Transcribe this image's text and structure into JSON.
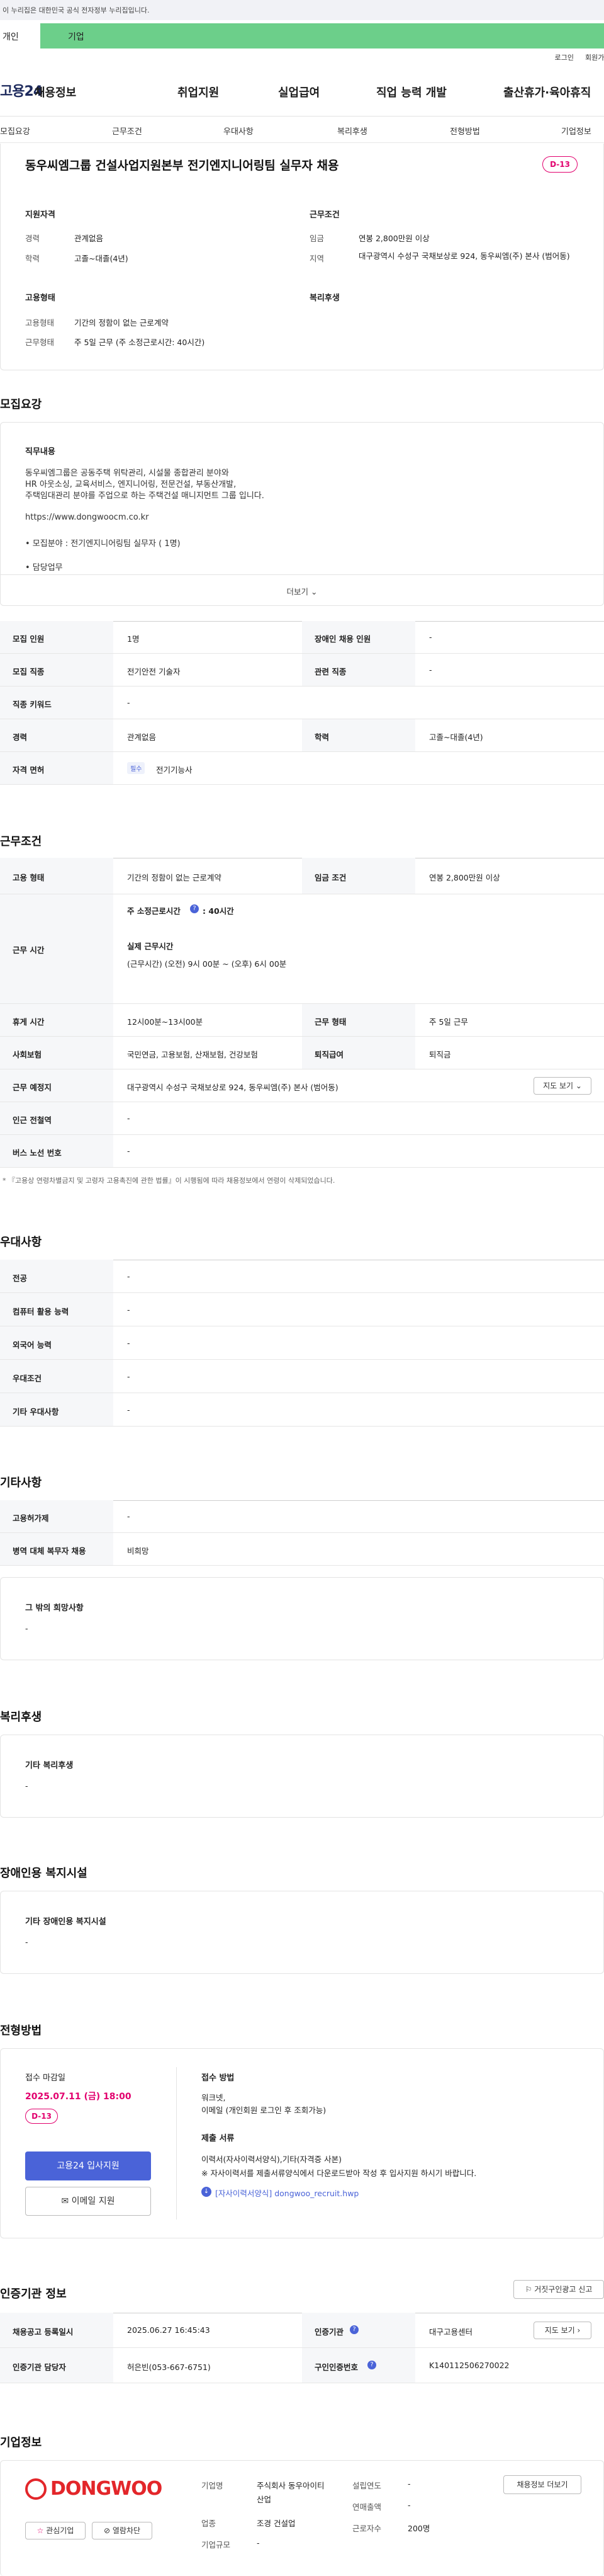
{
  "banner": {
    "text": "이 누리집은 대한민국 공식 전자정부 누리집입니다."
  },
  "segments": {
    "personal": "개인",
    "company": "기업"
  },
  "util": {
    "login": "로그인",
    "signup": "회원가입"
  },
  "gnb": {
    "logo": "고용24",
    "items": [
      "채용정보",
      "취업지원",
      "실업급여",
      "직업 능력 개발",
      "출산휴가·육아휴직"
    ]
  },
  "subnav": [
    "모집요강",
    "근무조건",
    "우대사항",
    "복리후생",
    "전형방법",
    "기업정보"
  ],
  "job": {
    "title": "동우씨엠그룹 건설사업지원본부 전기엔지니어링팀 실무자 채용",
    "dday": "D-13",
    "qual_title": "지원자격",
    "cond_title": "근무조건",
    "emp_title": "고용형태",
    "welfare_title": "복리후생",
    "qual": [
      {
        "k": "경력",
        "v": "관계없음"
      },
      {
        "k": "학력",
        "v": "고졸~대졸(4년)"
      }
    ],
    "cond": [
      {
        "k": "임금",
        "v": "연봉 2,800만원 이상"
      },
      {
        "k": "지역",
        "v": "대구광역시 수성구 국채보상로 924, 동우씨엠(주) 본사 (범어동)"
      }
    ],
    "emp": [
      {
        "k": "고용형태",
        "v": "기간의 정함이 없는 근로계약"
      },
      {
        "k": "근무형태",
        "v": "주 5일 근무 (주 소정근로시간: 40시간)"
      }
    ]
  },
  "recruit": {
    "title": "모집요강",
    "duty_title": "직무내용",
    "desc": [
      "동우씨엠그룹은 공동주택 위탁관리, 시설물 종합관리 분야와",
      "HR 아웃소싱, 교육서비스, 엔지니어링, 전문건설, 부동산개발,",
      "주택임대관리 분야를 주업으로 하는 주택건설 매니지먼트 그룹 입니다.",
      "",
      "https://www.dongwoocm.co.kr",
      "",
      "• 모집분야 : 전기엔지니어링팀 실무자 ( 1명)",
      "",
      "• 담당업무"
    ],
    "more": "더보기",
    "rows": [
      {
        "k1": "모집 인원",
        "v1": "1명",
        "k2": "장애인 채용 인원",
        "v2": "-"
      },
      {
        "k1": "모집 직종",
        "v1": "전기안전 기술자",
        "k2": "관련 직종",
        "v2": "-"
      },
      {
        "k1": "직종 키워드",
        "v1": "-"
      },
      {
        "k1": "경력",
        "v1": "관계없음",
        "k2": "학력",
        "v2": "고졸~대졸(4년)"
      },
      {
        "k1": "자격 면허",
        "badge": "필수",
        "v1": "전기기능사"
      }
    ]
  },
  "work": {
    "title": "근무조건",
    "type": {
      "k": "고용 형태",
      "v": "기간의 정함이 없는 근로계약",
      "k2": "임금 조건",
      "v2": "연봉 2,800만원 이상"
    },
    "time": {
      "k": "근무 시간",
      "l1": "주 소정근로시간",
      "l1v": ": 40시간",
      "l2": "실제 근무시간",
      "l3": "(근무시간) (오전) 9시 00분 ~ (오후) 6시 00분"
    },
    "rest": {
      "k": "휴게 시간",
      "v": "12시00분~13시00분",
      "k2": "근무 형태",
      "v2": "주 5일 근무"
    },
    "ins": {
      "k": "사회보험",
      "v": "국민연금, 고용보험, 산재보험, 건강보험",
      "k2": "퇴직급여",
      "v2": "퇴직금"
    },
    "place": {
      "k": "근무 예정지",
      "v": "대구광역시 수성구 국채보상로 924, 동우씨엠(주) 본사 (범어동)",
      "btn": "지도 보기"
    },
    "station": {
      "k": "인근 전철역",
      "v": "-"
    },
    "bus": {
      "k": "버스 노선 번호",
      "v": "-"
    },
    "note": "* 『고용상 연령차별금지 및 고령자 고용촉진에 관한 법률』이 시행됨에 따라 채용정보에서 연령이 삭제되었습니다."
  },
  "pref": {
    "title": "우대사항",
    "rows": [
      {
        "k": "전공",
        "v": "-"
      },
      {
        "k": "컴퓨터 활용 능력",
        "v": "-"
      },
      {
        "k": "외국어 능력",
        "v": "-"
      },
      {
        "k": "우대조건",
        "v": "-"
      },
      {
        "k": "기타 우대사항",
        "v": "-"
      }
    ]
  },
  "etc": {
    "title": "기타사항",
    "rows": [
      {
        "k": "고용허가제",
        "v": "-"
      },
      {
        "k": "병역 대체 복무자 채용",
        "v": "비희망"
      }
    ],
    "box_title": "그 밖의 희망사항",
    "box_val": "-"
  },
  "welfare": {
    "title": "복리후생",
    "box_title": "기타 복리후생",
    "box_val": "-"
  },
  "disab": {
    "title": "장애인용 복지시설",
    "box_title": "기타 장애인용 복지시설",
    "box_val": "-"
  },
  "proc": {
    "title": "전형방법",
    "deadline_label": "접수 마감일",
    "deadline": "2025.07.11 (금) 18:00",
    "dday": "D-13",
    "apply_btn": "고용24 입사지원",
    "email_btn": "이메일 지원",
    "method_title": "접수 방법",
    "methods": [
      "워크넷,",
      "이메일 (개인회원 로그인 후 조회가능)"
    ],
    "docs_title": "제출 서류",
    "docs": [
      "이력서(자사이력서양식),기타(자격증 사본)",
      "※ 자사이력서를 제출서류양식에서 다운로드받아 작성 후 입사지원 하시기 바랍니다."
    ],
    "file": "[자사이력서양식] dongwoo_recruit.hwp"
  },
  "cert": {
    "title": "인증기관 정보",
    "report_btn": "거짓구인광고 신고",
    "r1": {
      "k": "채용공고 등록일시",
      "v": "2025.06.27 16:45:43",
      "k2": "인증기관",
      "v2": "대구고용센터",
      "btn": "지도 보기"
    },
    "r2": {
      "k": "인증기관 담당자",
      "v": "허은빈(053-667-6751)",
      "k2": "구인인증번호",
      "v2": "K140112506270022"
    }
  },
  "company": {
    "title": "기업정보",
    "logo": "DONGWOO",
    "fav": "관심기업",
    "block": "열람차단",
    "fields": [
      {
        "k": "기업명",
        "v": "주식회사 동우아이티산업"
      },
      {
        "k": "업종",
        "v": "조경 건설업"
      },
      {
        "k": "기업규모",
        "v": "-"
      },
      {
        "k": "설립연도",
        "v": "-"
      },
      {
        "k": "연매출액",
        "v": "-"
      },
      {
        "k": "근로자수",
        "v": "200명"
      }
    ],
    "list_btn": "채용정보 더보기"
  },
  "colors": {
    "accent": "#e2006e",
    "brand": "#1d2a5c",
    "primary_btn": "#4a63d8",
    "green": "#6ccf8a"
  }
}
